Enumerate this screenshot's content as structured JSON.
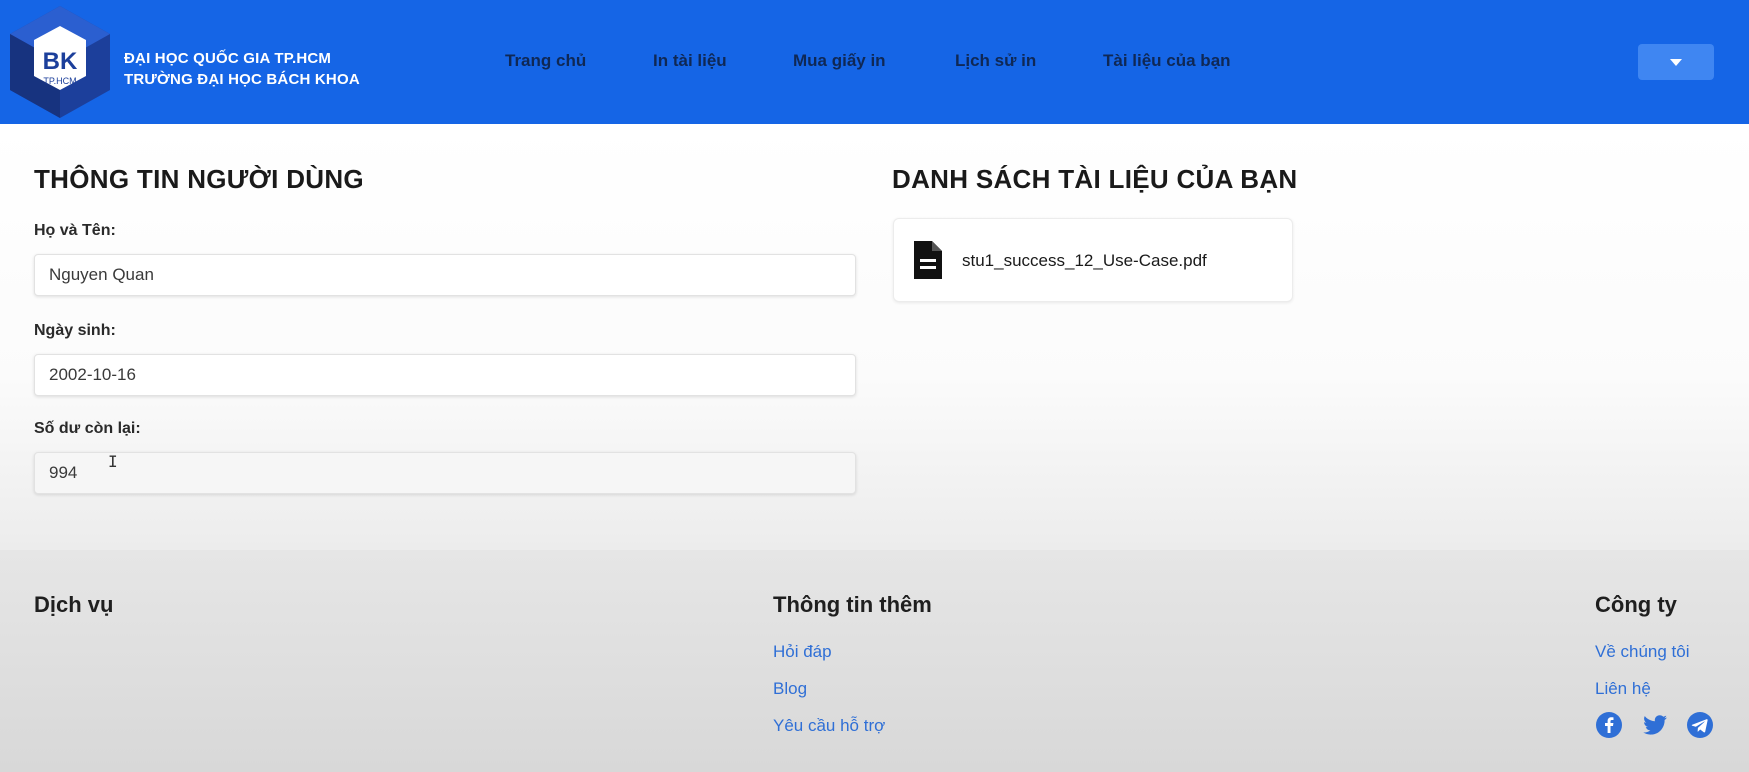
{
  "header": {
    "logo": {
      "letters": "BK",
      "subtitle": "TP.HCM"
    },
    "org_line1": "ĐẠI HỌC QUỐC GIA TP.HCM",
    "org_line2": "TRƯỜNG ĐẠI HỌC BÁCH KHOA",
    "nav": [
      {
        "label": "Trang chủ"
      },
      {
        "label": "In tài liệu"
      },
      {
        "label": "Mua giấy in"
      },
      {
        "label": "Lịch sử in"
      },
      {
        "label": "Tài liệu của bạn"
      }
    ],
    "user_menu_icon": "caret-down-icon"
  },
  "profile": {
    "title": "THÔNG TIN NGƯỜI DÙNG",
    "fields": [
      {
        "label": "Họ và Tên:",
        "value": "Nguyen Quan"
      },
      {
        "label": "Ngày sinh:",
        "value": "2002-10-16"
      },
      {
        "label": "Số dư còn lại:",
        "value": "994"
      }
    ]
  },
  "documents": {
    "title": "DANH SÁCH TÀI LIỆU CỦA BẠN",
    "files": [
      {
        "name": "stu1_success_12_Use-Case.pdf",
        "icon": "document-icon"
      }
    ]
  },
  "footer": {
    "services_title": "Dịch vụ",
    "info_title": "Thông tin thêm",
    "info_links": [
      "Hỏi đáp",
      "Blog",
      "Yêu cầu hỗ trợ"
    ],
    "company_title": "Công ty",
    "company_links": [
      "Về chúng tôi",
      "Liên hệ"
    ],
    "social_icons": [
      "facebook-icon",
      "twitter-icon",
      "telegram-icon"
    ]
  },
  "colors": {
    "header_bg": "#1565e6",
    "link": "#2f6fd6",
    "user_menu_bg": "#3f86f2"
  }
}
